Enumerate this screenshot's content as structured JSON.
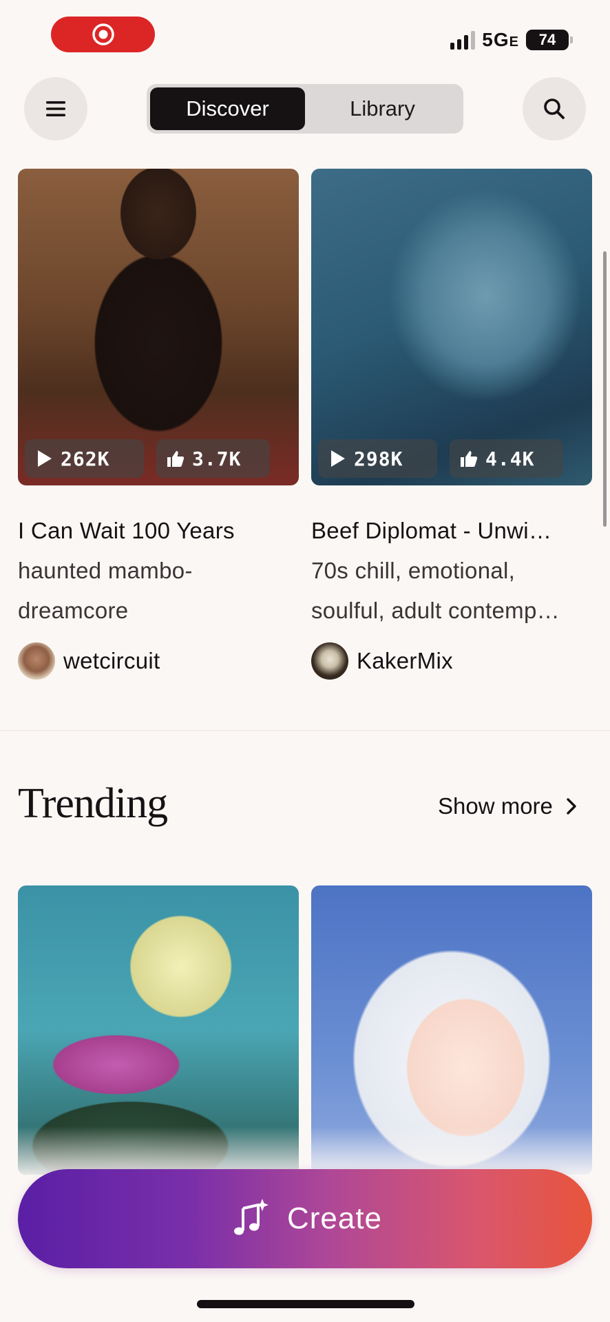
{
  "status_bar": {
    "network": "5G",
    "network_suffix": "E",
    "battery": "74"
  },
  "nav": {
    "tabs": [
      {
        "label": "Discover",
        "active": true
      },
      {
        "label": "Library",
        "active": false
      }
    ]
  },
  "cards_top": [
    {
      "plays": "262K",
      "likes": "3.7K",
      "title": "I Can Wait 100 Years",
      "description_lines": [
        "haunted mambo-",
        "dreamcore"
      ],
      "author": "wetcircuit"
    },
    {
      "plays": "298K",
      "likes": "4.4K",
      "title": "Beef Diplomat - Unwi…",
      "description_lines": [
        "70s chill, emotional,",
        "soulful, adult contemp…"
      ],
      "author": "KakerMix"
    }
  ],
  "trending": {
    "title": "Trending",
    "show_more": "Show more"
  },
  "create_button": {
    "label": "Create"
  },
  "colors": {
    "background": "#fbf7f5",
    "active_tab": "#161214",
    "record": "#dc2626",
    "create_gradient_start": "#5a1fa6",
    "create_gradient_end": "#e8553b"
  }
}
